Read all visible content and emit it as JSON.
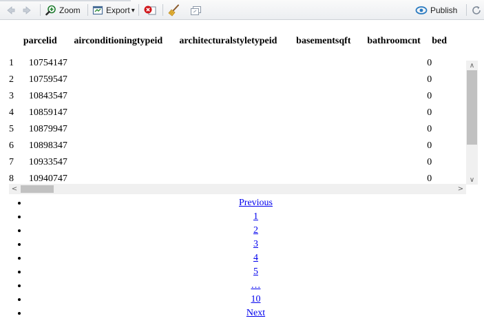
{
  "toolbar": {
    "zoom_label": "Zoom",
    "export_label": "Export",
    "export_caret": "▾",
    "publish_label": "Publish",
    "colors": {
      "zoom_icon": "#2e8b3a",
      "remove_icon": "#d0161a",
      "publish_icon": "#2a7bc1"
    }
  },
  "table": {
    "columns": [
      "",
      "parcelid",
      "airconditioningtypeid",
      "architecturalstyletypeid",
      "basementsqft",
      "bathroomcnt",
      "bed"
    ],
    "rows": [
      {
        "rowname": "1",
        "parcelid": "10754147",
        "bathroomcnt": "0"
      },
      {
        "rowname": "2",
        "parcelid": "10759547",
        "bathroomcnt": "0"
      },
      {
        "rowname": "3",
        "parcelid": "10843547",
        "bathroomcnt": "0"
      },
      {
        "rowname": "4",
        "parcelid": "10859147",
        "bathroomcnt": "0"
      },
      {
        "rowname": "5",
        "parcelid": "10879947",
        "bathroomcnt": "0"
      },
      {
        "rowname": "6",
        "parcelid": "10898347",
        "bathroomcnt": "0"
      },
      {
        "rowname": "7",
        "parcelid": "10933547",
        "bathroomcnt": "0"
      },
      {
        "rowname": "8",
        "parcelid": "10940747",
        "bathroomcnt": "0"
      }
    ]
  },
  "scrollbars": {
    "up": "∧",
    "down": "∨",
    "left": "<",
    "right": ">"
  },
  "pagination": [
    "Previous",
    "1",
    "2",
    "3",
    "4",
    "5",
    "…",
    "10",
    "Next"
  ]
}
